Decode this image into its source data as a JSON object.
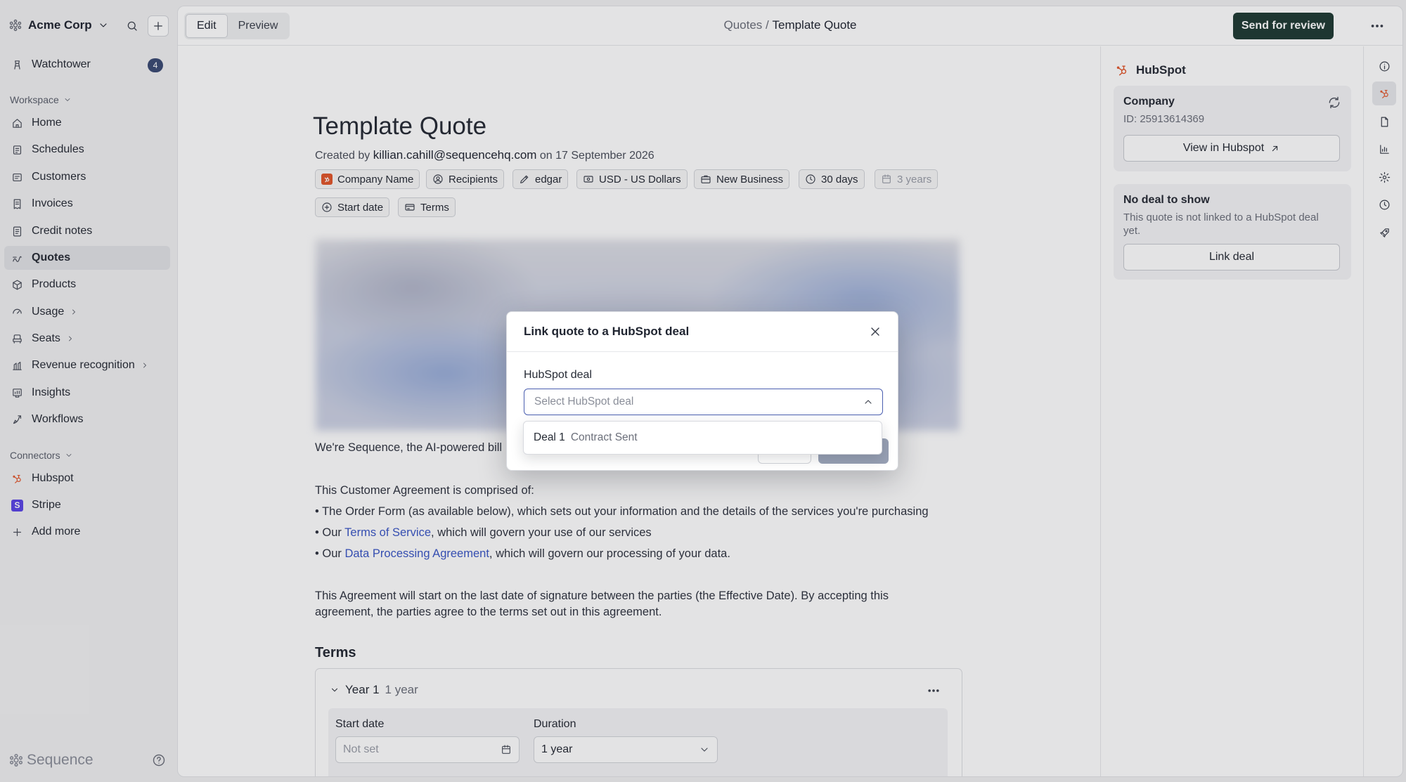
{
  "sidebar": {
    "org_name": "Acme Corp",
    "watchtower": {
      "label": "Watchtower",
      "count": "4"
    },
    "workspace_label": "Workspace",
    "items": [
      {
        "label": "Home",
        "icon": "home-icon"
      },
      {
        "label": "Schedules",
        "icon": "schedules-icon"
      },
      {
        "label": "Customers",
        "icon": "customers-icon"
      },
      {
        "label": "Invoices",
        "icon": "invoices-icon"
      },
      {
        "label": "Credit notes",
        "icon": "credit-notes-icon"
      },
      {
        "label": "Quotes",
        "icon": "quotes-icon",
        "active": true
      },
      {
        "label": "Products",
        "icon": "products-icon"
      },
      {
        "label": "Usage",
        "icon": "usage-icon"
      },
      {
        "label": "Seats",
        "icon": "seats-icon"
      },
      {
        "label": "Revenue recognition",
        "icon": "revenue-icon"
      },
      {
        "label": "Insights",
        "icon": "insights-icon"
      },
      {
        "label": "Workflows",
        "icon": "workflows-icon"
      }
    ],
    "connectors_label": "Connectors",
    "connectors": [
      {
        "label": "Hubspot",
        "icon": "hubspot-icon"
      },
      {
        "label": "Stripe",
        "icon": "stripe-icon",
        "glyph": "S"
      },
      {
        "label": "Add more",
        "icon": "plus-icon"
      }
    ],
    "brand": "Sequence"
  },
  "topbar": {
    "edit_label": "Edit",
    "preview_label": "Preview",
    "breadcrumb_parent": "Quotes",
    "breadcrumb_sep": " / ",
    "breadcrumb_current": "Template Quote",
    "send_label": "Send for review"
  },
  "doc": {
    "title": "Template Quote",
    "created_prefix": "Created by ",
    "created_by": "killian.cahill@sequencehq.com",
    "created_suffix": " on 17 September 2026",
    "chips": {
      "company": "Company Name",
      "recipients": "Recipients",
      "owner": "edgar",
      "currency": "USD - US Dollars",
      "deal_type": "New Business",
      "expiry": "30 days",
      "duration": "3 years",
      "start_date": "Start date",
      "terms": "Terms"
    },
    "intro": "We're Sequence, the AI-powered bill",
    "agreement_intro": "This Customer Agreement is comprised of:",
    "bullet1": "• The Order Form (as available below), which sets out your information and the details of the services you're purchasing",
    "bullet2_pre": "• Our ",
    "bullet2_link": "Terms of Service",
    "bullet2_post": ", which will govern your use of our services",
    "bullet3_pre": "• Our ",
    "bullet3_link": "Data Processing Agreement",
    "bullet3_post": ", which will govern our processing of your data.",
    "agreement_line1": "This Agreement will start on the last date of signature between the parties (the Effective Date). By accepting this",
    "agreement_line2": "agreement, the parties agree to the terms set out in this agreement.",
    "terms_heading": "Terms",
    "term": {
      "name": "Year 1",
      "length": "1 year",
      "start_label": "Start date",
      "start_placeholder": "Not set",
      "duration_label": "Duration",
      "duration_value": "1 year"
    }
  },
  "hubspot_panel": {
    "title": "HubSpot",
    "company_label": "Company",
    "company_id": "ID: 25913614369",
    "view_button": "View in Hubspot",
    "no_deal_title": "No deal to show",
    "no_deal_line1": "This quote is not linked to a HubSpot deal",
    "no_deal_line2": "yet.",
    "link_button": "Link deal"
  },
  "modal": {
    "title": "Link quote to a HubSpot deal",
    "field_label": "HubSpot deal",
    "select_placeholder": "Select HubSpot deal",
    "options": [
      {
        "name": "Deal 1",
        "status": "Contract Sent"
      }
    ]
  },
  "colors": {
    "accent_dark": "#1f3b34",
    "hubspot": "#e2562b",
    "link": "#3a56c5",
    "badge": "#3b4a74"
  }
}
